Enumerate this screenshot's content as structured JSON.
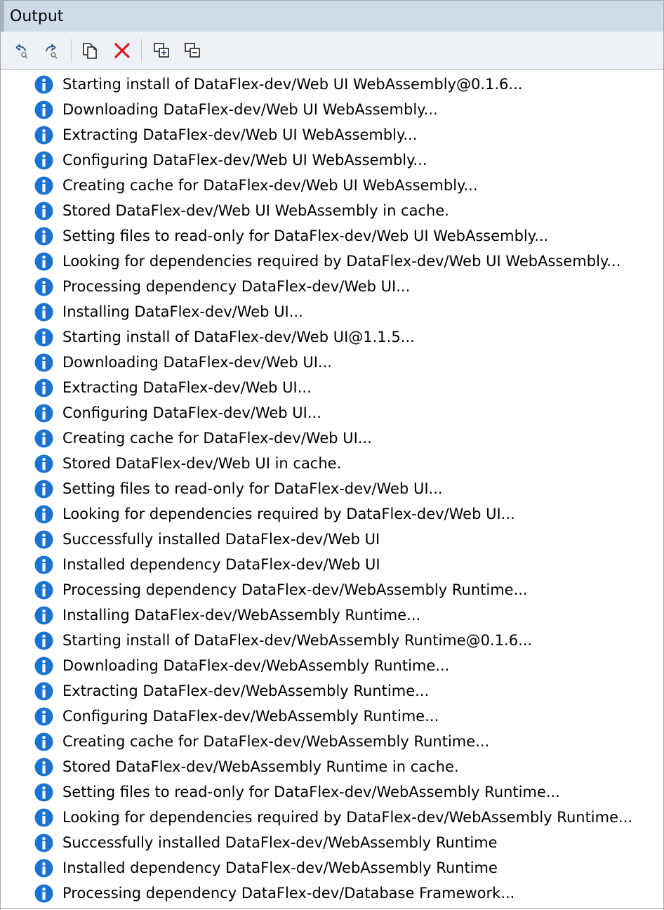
{
  "panel": {
    "title": "Output"
  },
  "toolbar": {
    "buttons": [
      {
        "name": "previous-message-button",
        "icon": "back-arrow-icon"
      },
      {
        "name": "next-message-button",
        "icon": "forward-arrow-icon"
      },
      {
        "name": "copy-button",
        "icon": "copy-icon"
      },
      {
        "name": "clear-button",
        "icon": "red-x-icon"
      },
      {
        "name": "expand-all-button",
        "icon": "expand-windows-icon"
      },
      {
        "name": "collapse-all-button",
        "icon": "collapse-windows-icon"
      }
    ]
  },
  "colors": {
    "info_icon": "#1b73d1",
    "titlebar": "#d0dbe9",
    "clear_icon": "#d42020"
  },
  "messages": [
    "Starting install of DataFlex-dev/Web UI WebAssembly@0.1.6...",
    "Downloading DataFlex-dev/Web UI WebAssembly...",
    "Extracting DataFlex-dev/Web UI WebAssembly...",
    "Configuring DataFlex-dev/Web UI WebAssembly...",
    "Creating cache for DataFlex-dev/Web UI WebAssembly...",
    "Stored DataFlex-dev/Web UI WebAssembly in cache.",
    "Setting files to read-only for DataFlex-dev/Web UI WebAssembly...",
    "Looking for dependencies required by DataFlex-dev/Web UI WebAssembly...",
    "Processing dependency DataFlex-dev/Web UI...",
    "Installing DataFlex-dev/Web UI...",
    "Starting install of DataFlex-dev/Web UI@1.1.5...",
    "Downloading DataFlex-dev/Web UI...",
    "Extracting DataFlex-dev/Web UI...",
    "Configuring DataFlex-dev/Web UI...",
    "Creating cache for DataFlex-dev/Web UI...",
    "Stored DataFlex-dev/Web UI in cache.",
    "Setting files to read-only for DataFlex-dev/Web UI...",
    "Looking for dependencies required by DataFlex-dev/Web UI...",
    "Successfully installed DataFlex-dev/Web UI",
    "Installed dependency DataFlex-dev/Web UI",
    "Processing dependency DataFlex-dev/WebAssembly Runtime...",
    "Installing DataFlex-dev/WebAssembly Runtime...",
    "Starting install of DataFlex-dev/WebAssembly Runtime@0.1.6...",
    "Downloading DataFlex-dev/WebAssembly Runtime...",
    "Extracting DataFlex-dev/WebAssembly Runtime...",
    "Configuring DataFlex-dev/WebAssembly Runtime...",
    "Creating cache for DataFlex-dev/WebAssembly Runtime...",
    "Stored DataFlex-dev/WebAssembly Runtime in cache.",
    "Setting files to read-only for DataFlex-dev/WebAssembly Runtime...",
    "Looking for dependencies required by DataFlex-dev/WebAssembly Runtime...",
    "Successfully installed DataFlex-dev/WebAssembly Runtime",
    "Installed dependency DataFlex-dev/WebAssembly Runtime",
    "Processing dependency DataFlex-dev/Database Framework..."
  ]
}
